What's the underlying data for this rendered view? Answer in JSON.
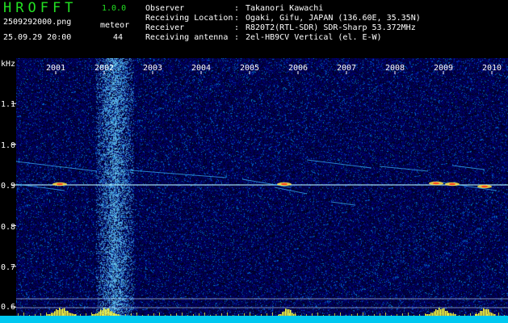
{
  "app": {
    "title": "HROFFT",
    "version": "1.0.0"
  },
  "capture": {
    "filename": "2509292000.png",
    "timestamp": "25.09.29 20:00"
  },
  "meteor": {
    "label": "meteor",
    "count": "44"
  },
  "info": [
    {
      "label": "Observer",
      "value": "Takanori Kawachi"
    },
    {
      "label": "Receiving Location",
      "value": "Ogaki, Gifu, JAPAN (136.60E, 35.35N)"
    },
    {
      "label": "Receiver",
      "value": "R820T2(RTL-SDR) SDR-Sharp 53.372MHz"
    },
    {
      "label": "Receiving antenna",
      "value": "2el-HB9CV Vertical (el. E-W)"
    }
  ],
  "info_separator": ":",
  "axis": {
    "unit": "kHz",
    "freq_ticks": [
      "1.1",
      "1.0",
      "0.9",
      "0.8",
      "0.7",
      "0.6"
    ],
    "freq_values": [
      1.1,
      1.0,
      0.9,
      0.8,
      0.7,
      0.6
    ],
    "time_ticks": [
      "2001",
      "2002",
      "2003",
      "2004",
      "2005",
      "2006",
      "2007",
      "2008",
      "2009",
      "2010"
    ]
  },
  "colors": {
    "title": "#22e022",
    "text": "#ffffff",
    "background": "#000000",
    "noise": "#0a0a8c",
    "signal": "#00ffff",
    "baseline": "#00e0ff",
    "peak": "#ffff00"
  }
}
